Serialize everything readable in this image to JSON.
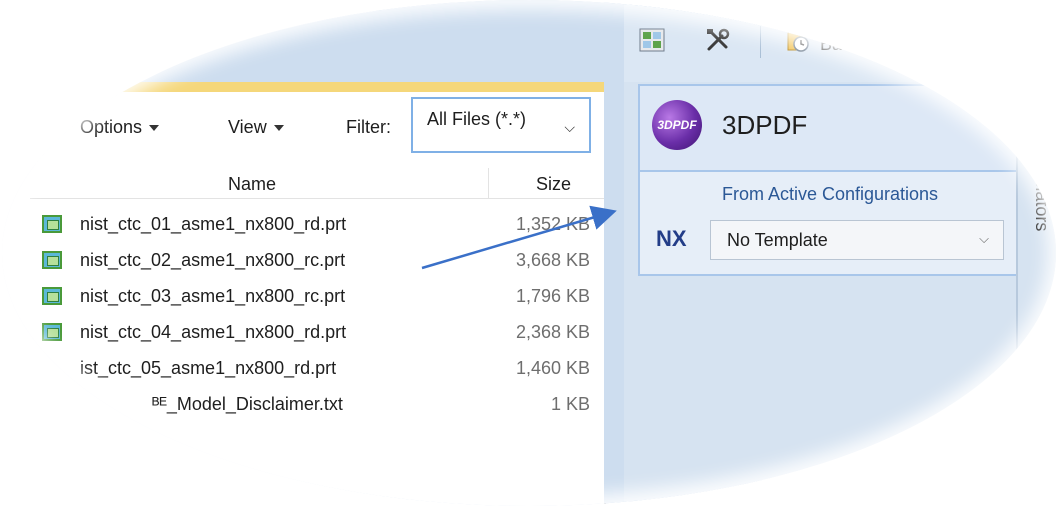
{
  "file_browser": {
    "options_label": "Options",
    "view_label": "View",
    "filter_label": "Filter:",
    "filter_value": "All Files (*.*)",
    "columns": {
      "name": "Name",
      "size": "Size"
    },
    "files": [
      {
        "name": "nist_ctc_01_asme1_nx800_rd.prt",
        "size": "1,352 KB",
        "icon": "nx-part-icon"
      },
      {
        "name": "nist_ctc_02_asme1_nx800_rc.prt",
        "size": "3,668 KB",
        "icon": "nx-part-icon"
      },
      {
        "name": "nist_ctc_03_asme1_nx800_rc.prt",
        "size": "1,796 KB",
        "icon": "nx-part-icon"
      },
      {
        "name": "nist_ctc_04_asme1_nx800_rd.prt",
        "size": "2,368 KB",
        "icon": "nx-part-icon"
      },
      {
        "name": "ist_ctc_05_asme1_nx800_rd.prt",
        "size": "1,460 KB",
        "icon": ""
      },
      {
        "name": "ᴮᴱ_Model_Disclaimer.txt",
        "size": "1 KB",
        "icon": ""
      }
    ]
  },
  "right_panel": {
    "toolbar": {
      "batch_label": "Batc"
    },
    "card_title": "3DPDF",
    "logo_text": "3DPDF",
    "config_label": "From Active Configurations",
    "nx_label": "NX",
    "template_value": "No Template",
    "side_tab": "Translators"
  },
  "colors": {
    "arrow": "#3a70c8",
    "accent_blue": "#2b5896",
    "panel_bg": "#d6e3f1"
  }
}
